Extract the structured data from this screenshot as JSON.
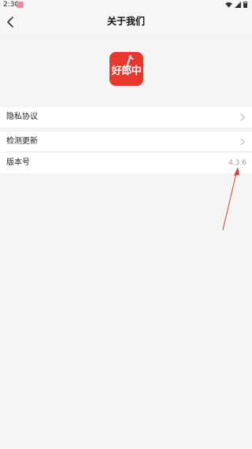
{
  "status_bar": {
    "time": "2:30"
  },
  "nav": {
    "title": "关于我们"
  },
  "logo": {
    "text": "好郎中"
  },
  "menu": {
    "privacy_label": "隐私协议",
    "update_label": "检测更新",
    "version_label": "版本号",
    "version_value": "4.3.6"
  },
  "colors": {
    "brand": "#e8372c",
    "annotation_arrow": "#d93a3a"
  }
}
